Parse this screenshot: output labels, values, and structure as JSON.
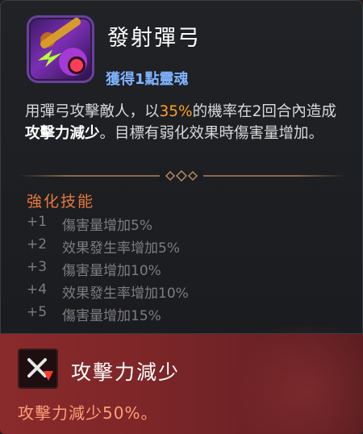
{
  "skill": {
    "icon": "bow-skill-icon",
    "name": "發射彈弓",
    "gain": "獲得1點靈魂",
    "description": {
      "part1": "用彈弓攻擊敵人，以",
      "chance": "35%",
      "part2": "的機率在2回合內造成",
      "effect": "攻擊力減少",
      "part3": "。目標有弱化效果時傷害量增加。"
    }
  },
  "enhancement": {
    "title": "強化技能",
    "items": [
      {
        "level": "+1",
        "text": "傷害量增加5%"
      },
      {
        "level": "+2",
        "text": "效果發生率增加5%"
      },
      {
        "level": "+3",
        "text": "傷害量增加10%"
      },
      {
        "level": "+4",
        "text": "效果發生率增加10%"
      },
      {
        "level": "+5",
        "text": "傷害量增加15%"
      }
    ]
  },
  "debuff": {
    "icon": "attack-down-icon",
    "title": "攻擊力減少",
    "description": "攻擊力減少50%。"
  },
  "colors": {
    "highlight": "#ffa01c",
    "section": "#e6793a",
    "gain": "#7fb3ff",
    "debuff_bg": "#8a2a2c",
    "debuff_text": "#ff9f76"
  }
}
